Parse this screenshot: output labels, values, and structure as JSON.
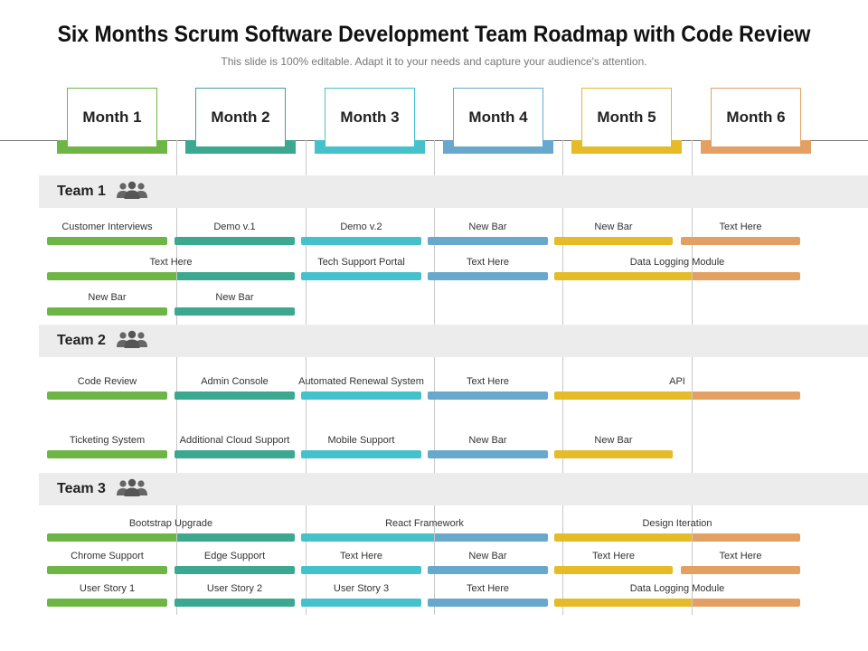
{
  "title": "Six Months Scrum Software Development Team Roadmap with Code Review",
  "subtitle": "This slide is 100% editable. Adapt it to your needs and capture your audience's attention.",
  "colors": {
    "month1": "#6db646",
    "month2": "#3ba88f",
    "month3": "#45c1cc",
    "month4": "#67a8cc",
    "month5": "#e5bb27",
    "month6": "#e4a062"
  },
  "months": [
    "Month 1",
    "Month 2",
    "Month 3",
    "Month 4",
    "Month 5",
    "Month 6"
  ],
  "teams": [
    {
      "name": "Team 1",
      "icon": "people-group-icon",
      "rows": [
        [
          {
            "label": "Customer Interviews",
            "start": 1,
            "end": 1
          },
          {
            "label": "Demo v.1",
            "start": 2,
            "end": 2
          },
          {
            "label": "Demo v.2",
            "start": 3,
            "end": 3
          },
          {
            "label": "New Bar",
            "start": 4,
            "end": 4
          },
          {
            "label": "New Bar",
            "start": 5,
            "end": 5
          },
          {
            "label": "Text Here",
            "start": 6,
            "end": 6
          }
        ],
        [
          {
            "label": "Text Here",
            "start": 1,
            "end": 2
          },
          {
            "label": "Tech Support Portal",
            "start": 3,
            "end": 3
          },
          {
            "label": "Text Here",
            "start": 4,
            "end": 4
          },
          {
            "label": "Data Logging Module",
            "start": 5,
            "end": 6
          }
        ],
        [
          {
            "label": "New Bar",
            "start": 1,
            "end": 1
          },
          {
            "label": "New Bar",
            "start": 2,
            "end": 2
          }
        ]
      ]
    },
    {
      "name": "Team 2",
      "icon": "people-group-icon",
      "rows": [
        [
          {
            "label": "Code Review",
            "start": 1,
            "end": 1
          },
          {
            "label": "Admin Console",
            "start": 2,
            "end": 2
          },
          {
            "label": "Automated Renewal System",
            "start": 3,
            "end": 3
          },
          {
            "label": "Text Here",
            "start": 4,
            "end": 4
          },
          {
            "label": "API",
            "start": 5,
            "end": 6
          }
        ],
        [
          {
            "label": "Ticketing System",
            "start": 1,
            "end": 1
          },
          {
            "label": "Additional Cloud Support",
            "start": 2,
            "end": 2
          },
          {
            "label": "Mobile Support",
            "start": 3,
            "end": 3
          },
          {
            "label": "New Bar",
            "start": 4,
            "end": 4
          },
          {
            "label": "New Bar",
            "start": 5,
            "end": 5
          }
        ]
      ]
    },
    {
      "name": "Team 3",
      "icon": "people-group-icon",
      "rows": [
        [
          {
            "label": "Bootstrap Upgrade",
            "start": 1,
            "end": 2
          },
          {
            "label": "React Framework",
            "start": 3,
            "end": 4
          },
          {
            "label": "Design Iteration",
            "start": 5,
            "end": 6
          }
        ],
        [
          {
            "label": "Chrome Support",
            "start": 1,
            "end": 1
          },
          {
            "label": "Edge Support",
            "start": 2,
            "end": 2
          },
          {
            "label": "Text Here",
            "start": 3,
            "end": 3
          },
          {
            "label": "New Bar",
            "start": 4,
            "end": 4
          },
          {
            "label": "Text Here",
            "start": 5,
            "end": 5
          },
          {
            "label": "Text Here",
            "start": 6,
            "end": 6
          }
        ],
        [
          {
            "label": "User Story 1",
            "start": 1,
            "end": 1
          },
          {
            "label": "User Story 2",
            "start": 2,
            "end": 2
          },
          {
            "label": "User Story 3",
            "start": 3,
            "end": 3
          },
          {
            "label": "Text Here",
            "start": 4,
            "end": 4
          },
          {
            "label": "Data Logging Module",
            "start": 5,
            "end": 6
          }
        ]
      ]
    }
  ]
}
